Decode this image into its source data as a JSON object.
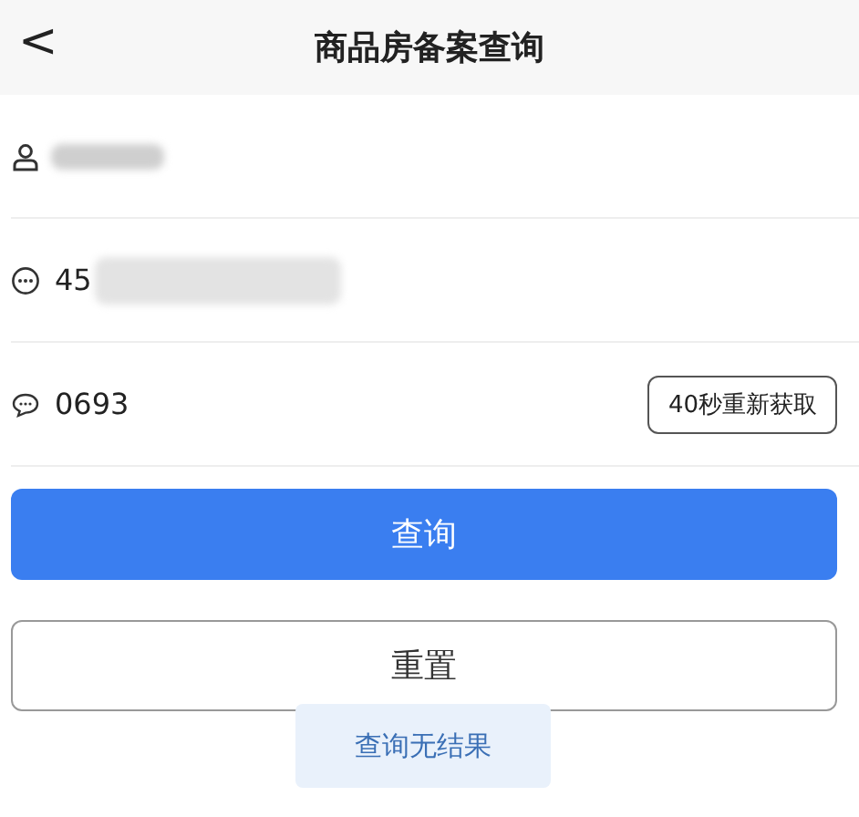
{
  "header": {
    "back_icon": "<",
    "title": "商品房备案查询"
  },
  "fields": [
    {
      "kind": "person",
      "redacted": true
    },
    {
      "kind": "id",
      "value": "45",
      "redacted": true
    },
    {
      "kind": "code",
      "value": "0693",
      "action": "40秒重新获取"
    }
  ],
  "buttons": [
    {
      "label": "查询",
      "kind": "primary"
    },
    {
      "label": "重置",
      "kind": "outline"
    }
  ],
  "toast": "查询无结果"
}
